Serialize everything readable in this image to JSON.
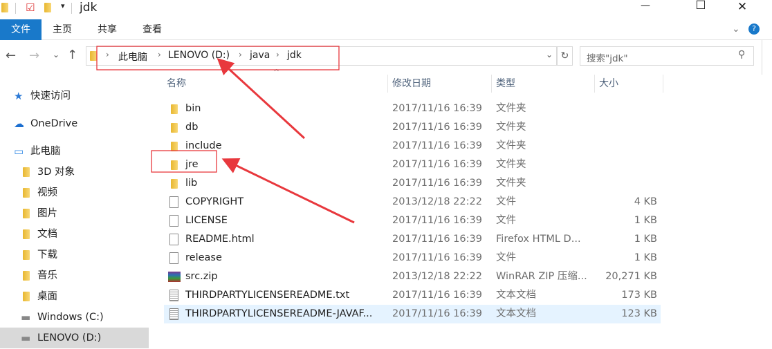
{
  "window": {
    "title": "jdk",
    "controls": [
      "—",
      "☐",
      "✕"
    ]
  },
  "ribbon": {
    "tabs": [
      "文件",
      "主页",
      "共享",
      "查看"
    ]
  },
  "address": {
    "crumbs": [
      "此电脑",
      "LENOVO (D:)",
      "java",
      "jdk"
    ],
    "search_placeholder": "搜索\"jdk\""
  },
  "columns": [
    "名称",
    "修改日期",
    "类型",
    "大小"
  ],
  "sidebar": [
    {
      "label": "快速访问",
      "icon": "star-icon",
      "indent": 0
    },
    {
      "label": "OneDrive",
      "icon": "cloud-icon",
      "indent": 0
    },
    {
      "label": "此电脑",
      "icon": "computer-icon",
      "indent": 0
    },
    {
      "label": "3D 对象",
      "icon": "folder-3d-icon",
      "indent": 1
    },
    {
      "label": "视频",
      "icon": "folder-video-icon",
      "indent": 1
    },
    {
      "label": "图片",
      "icon": "folder-pictures-icon",
      "indent": 1
    },
    {
      "label": "文档",
      "icon": "folder-documents-icon",
      "indent": 1
    },
    {
      "label": "下载",
      "icon": "folder-downloads-icon",
      "indent": 1
    },
    {
      "label": "音乐",
      "icon": "folder-music-icon",
      "indent": 1
    },
    {
      "label": "桌面",
      "icon": "folder-desktop-icon",
      "indent": 1
    },
    {
      "label": "Windows (C:)",
      "icon": "drive-icon",
      "indent": 1
    },
    {
      "label": "LENOVO (D:)",
      "icon": "drive-icon",
      "indent": 1,
      "selected": true
    }
  ],
  "files": [
    {
      "name": "bin",
      "date": "2017/11/16 16:39",
      "type": "文件夹",
      "size": "",
      "kind": "folder"
    },
    {
      "name": "db",
      "date": "2017/11/16 16:39",
      "type": "文件夹",
      "size": "",
      "kind": "folder"
    },
    {
      "name": "include",
      "date": "2017/11/16 16:39",
      "type": "文件夹",
      "size": "",
      "kind": "folder"
    },
    {
      "name": "jre",
      "date": "2017/11/16 16:39",
      "type": "文件夹",
      "size": "",
      "kind": "folder"
    },
    {
      "name": "lib",
      "date": "2017/11/16 16:39",
      "type": "文件夹",
      "size": "",
      "kind": "folder"
    },
    {
      "name": "COPYRIGHT",
      "date": "2013/12/18 22:22",
      "type": "文件",
      "size": "4 KB",
      "kind": "file"
    },
    {
      "name": "LICENSE",
      "date": "2017/11/16 16:39",
      "type": "文件",
      "size": "1 KB",
      "kind": "file"
    },
    {
      "name": "README.html",
      "date": "2017/11/16 16:39",
      "type": "Firefox HTML D...",
      "size": "1 KB",
      "kind": "file"
    },
    {
      "name": "release",
      "date": "2017/11/16 16:39",
      "type": "文件",
      "size": "1 KB",
      "kind": "file"
    },
    {
      "name": "src.zip",
      "date": "2013/12/18 22:22",
      "type": "WinRAR ZIP 压缩...",
      "size": "20,271 KB",
      "kind": "zip"
    },
    {
      "name": "THIRDPARTYLICENSEREADME.txt",
      "date": "2017/11/16 16:39",
      "type": "文本文档",
      "size": "173 KB",
      "kind": "text"
    },
    {
      "name": "THIRDPARTYLICENSEREADME-JAVAF...",
      "date": "2017/11/16 16:39",
      "type": "文本文档",
      "size": "123 KB",
      "kind": "text",
      "selected": true
    }
  ],
  "colors": {
    "accent": "#1979ca",
    "annotation": "#e8383d",
    "selection": "#e5f3ff"
  }
}
